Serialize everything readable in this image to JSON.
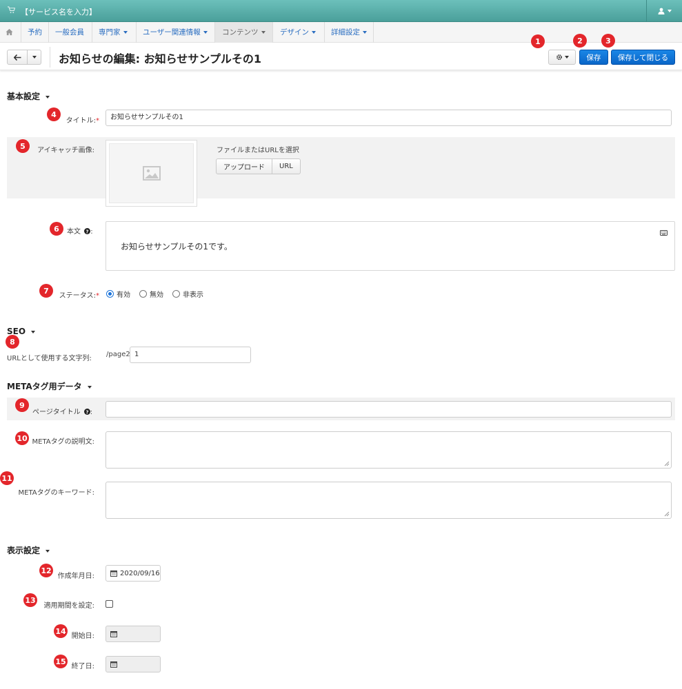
{
  "topbar": {
    "service_name": "【サービス名を入力】",
    "cart_icon": "cart-icon",
    "user_icon": "user-icon"
  },
  "nav": {
    "home_icon": "home-icon",
    "items": [
      {
        "label": "予約",
        "dropdown": false
      },
      {
        "label": "一般会員",
        "dropdown": false
      },
      {
        "label": "専門家",
        "dropdown": true
      },
      {
        "label": "ユーザー関連情報",
        "dropdown": true
      },
      {
        "label": "コンテンツ",
        "dropdown": true,
        "active": true
      },
      {
        "label": "デザイン",
        "dropdown": true
      },
      {
        "label": "詳細設定",
        "dropdown": true
      }
    ]
  },
  "header": {
    "title": "お知らせの編集: お知らせサンプルその1",
    "save_label": "保存",
    "save_close_label": "保存して閉じる"
  },
  "badges": [
    "1",
    "2",
    "3",
    "4",
    "5",
    "6",
    "7",
    "8",
    "9",
    "10",
    "11",
    "12",
    "13",
    "14",
    "15"
  ],
  "basic": {
    "section_label": "基本設定",
    "title_label": "タイトル:",
    "title_required": "*",
    "title_value": "お知らせサンプルその1",
    "eyecatch_label": "アイキャッチ画像:",
    "file_hint": "ファイルまたはURLを選択",
    "upload_label": "アップロード",
    "url_label": "URL",
    "body_label": "本文",
    "body_text": "お知らせサンプルその1です。",
    "status_label": "ステータス:",
    "status_required": "*",
    "status_options": [
      "有効",
      "無効",
      "非表示"
    ],
    "status_selected": "有効"
  },
  "seo": {
    "section_label": "SEO",
    "url_label": "URLとして使用する文字列:",
    "url_prefix": "/page2/",
    "url_value": "1"
  },
  "meta": {
    "section_label": "METAタグ用データ",
    "page_title_label": "ページタイトル",
    "page_title_value": "",
    "description_label": "METAタグの説明文:",
    "keywords_label": "METAタグのキーワード:"
  },
  "display": {
    "section_label": "表示設定",
    "created_label": "作成年月日:",
    "created_value": "2020/09/16",
    "period_label": "適用期間を設定:",
    "start_label": "開始日:",
    "end_label": "終了日:"
  },
  "colors": {
    "topbar": "#5aafaa",
    "accent_blue": "#0a66c8",
    "badge_red": "#e3262b",
    "link_blue": "#2a6ec1"
  }
}
